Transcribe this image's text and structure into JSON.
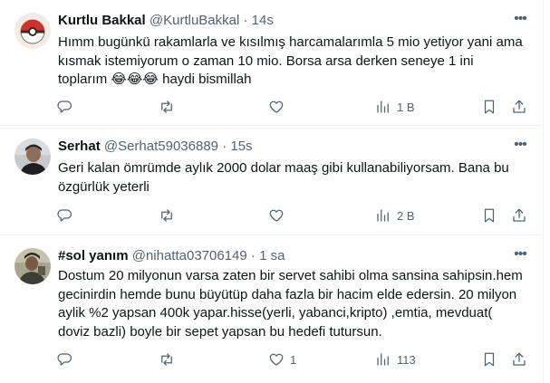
{
  "tweets": [
    {
      "name": "Kurtlu Bakkal",
      "handle": "@KurtluBakkal",
      "dot": "·",
      "time": "14s",
      "text": "Hımm bugünkü rakamlarla ve kısılmış harcamalarımla 5 mio yetiyor yani ama kısmak istemiyorum o zaman 10 mio. Borsa arsa derken seneye 1 ini toplarım 😂😂😂 haydi bismillah",
      "replies": "",
      "retweets": "",
      "likes": "",
      "views": "1 B",
      "avatar_icon": "pokeball-avatar-icon"
    },
    {
      "name": "Serhat",
      "handle": "@Serhat59036889",
      "dot": "·",
      "time": "15s",
      "text": "Geri kalan ömrümde aylık 2000 dolar maaş gibi kullanabiliyorsam. Bana bu özgürlük yeterli",
      "replies": "",
      "retweets": "",
      "likes": "",
      "views": "2 B",
      "avatar_icon": "person-photo-avatar-icon"
    },
    {
      "name": "#sol yanım",
      "handle": "@nihatta03706149",
      "dot": "·",
      "time": "1 sa",
      "text": "Dostum 20 milyonun varsa zaten bir servet sahibi olma sansina sahipsin.hem gecinirdin hemde bunu büyütüp daha fazla bir hacim elde edersin. 20 milyon aylik  %2 yapsan 400k yapar.hisse(yerli, yabanci,kripto) ,emtia, mevduat( doviz bazli) boyle bir sepet yapsan bu hedefi tutursun.",
      "replies": "",
      "retweets": "",
      "likes": "1",
      "views": "113",
      "avatar_icon": "person-photo-avatar-icon"
    }
  ],
  "colors": {
    "text": "#0f1419",
    "secondary": "#536471",
    "divider": "#eff3f4"
  },
  "icons": [
    "reply-icon",
    "retweet-icon",
    "like-icon",
    "views-icon",
    "bookmark-icon",
    "share-icon",
    "more-icon"
  ]
}
